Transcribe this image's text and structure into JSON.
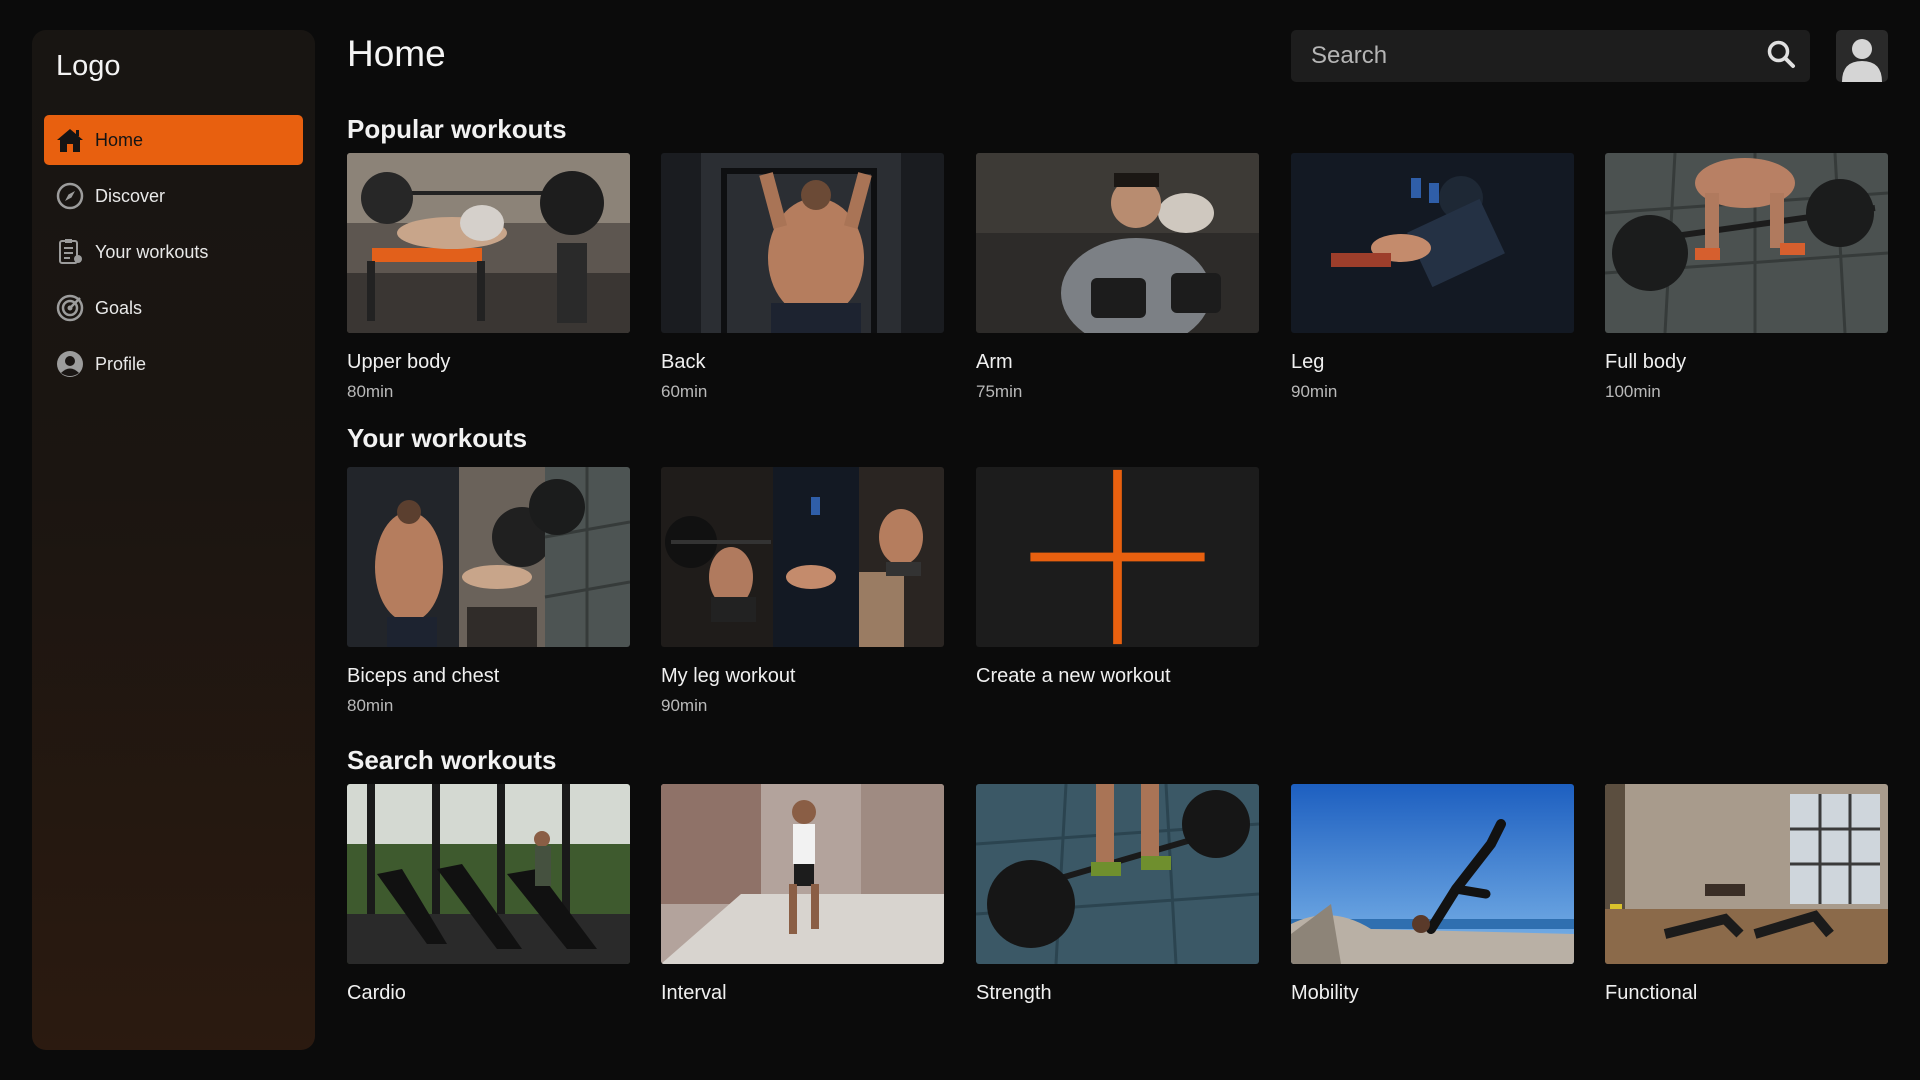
{
  "sidebar": {
    "logo": "Logo",
    "items": [
      {
        "label": "Home",
        "icon": "home-icon",
        "active": true
      },
      {
        "label": "Discover",
        "icon": "compass-icon"
      },
      {
        "label": "Your workouts",
        "icon": "clipboard-icon"
      },
      {
        "label": "Goals",
        "icon": "target-icon"
      },
      {
        "label": "Profile",
        "icon": "user-circle-icon"
      }
    ]
  },
  "header": {
    "title": "Home",
    "search_placeholder": "Search"
  },
  "popular": {
    "title": "Popular workouts",
    "cards": [
      {
        "title": "Upper body",
        "duration": "80min"
      },
      {
        "title": "Back",
        "duration": "60min"
      },
      {
        "title": "Arm",
        "duration": "75min"
      },
      {
        "title": "Leg",
        "duration": "90min"
      },
      {
        "title": "Full body",
        "duration": "100min"
      }
    ]
  },
  "yours": {
    "title": "Your workouts",
    "cards": [
      {
        "title": "Biceps and chest",
        "duration": "80min"
      },
      {
        "title": "My leg workout",
        "duration": "90min"
      }
    ],
    "create_label": "Create a new workout"
  },
  "search_workouts": {
    "title": "Search workouts",
    "cards": [
      {
        "title": "Cardio"
      },
      {
        "title": "Interval"
      },
      {
        "title": "Strength"
      },
      {
        "title": "Mobility"
      },
      {
        "title": "Functional"
      }
    ]
  },
  "colors": {
    "accent": "#e8600f",
    "background": "#0b0b0b",
    "card_bg": "#1c1c1c"
  }
}
